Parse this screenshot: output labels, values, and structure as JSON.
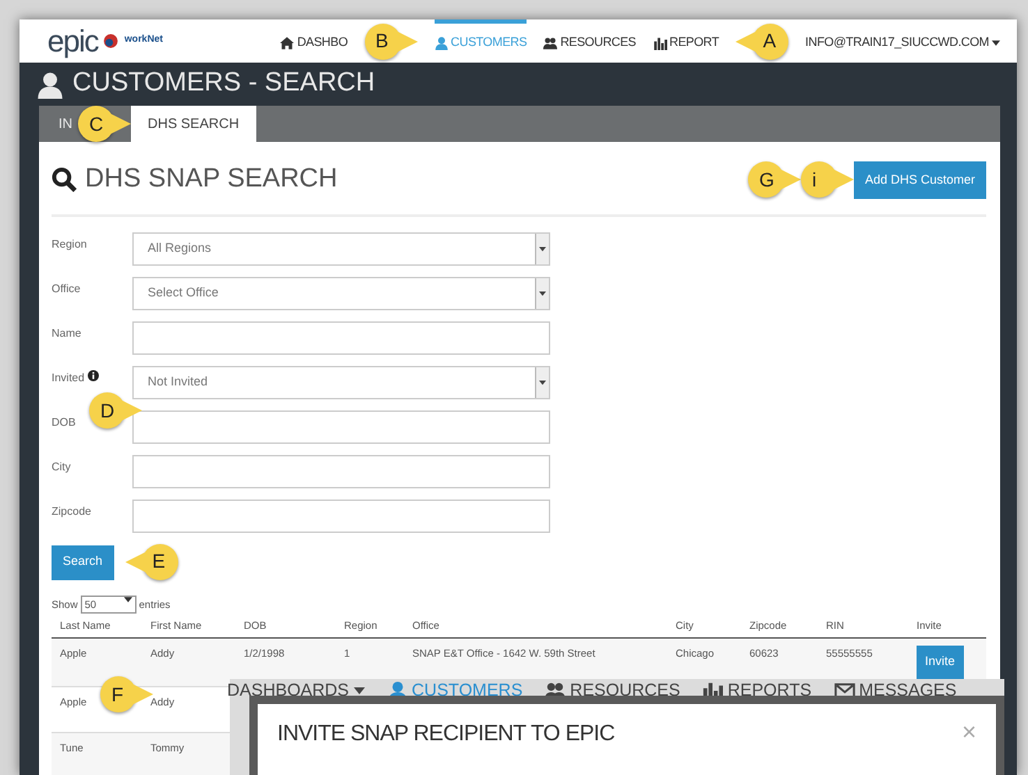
{
  "navbar": {
    "logo": "epic",
    "partner_logo": "workNet",
    "items": [
      {
        "label": "DASHBO",
        "selected": false
      },
      {
        "label": "CUSTOMERS",
        "selected": true
      },
      {
        "label": "RESOURCES",
        "selected": false
      },
      {
        "label": "REPORT",
        "selected": false
      },
      {
        "label": "INFO@TRAIN17_SIUCCWD.COM",
        "selected": false
      }
    ]
  },
  "page_title": "CUSTOMERS - SEARCH",
  "tabs": [
    {
      "label": "IN",
      "selected": false
    },
    {
      "label": "DHS SEARCH",
      "selected": true
    }
  ],
  "panel": {
    "title": "DHS SNAP SEARCH",
    "add_button": "Add DHS Customer"
  },
  "form": [
    {
      "kind": "select",
      "label": "Region",
      "value": "All Regions"
    },
    {
      "kind": "select",
      "label": "Office",
      "value": "Select Office"
    },
    {
      "kind": "text",
      "label": "Name"
    },
    {
      "kind": "select",
      "label": "Invited",
      "value": "Not Invited",
      "info": true
    },
    {
      "kind": "text",
      "label": "DOB"
    },
    {
      "kind": "text",
      "label": "City"
    },
    {
      "kind": "text",
      "label": "Zipcode"
    }
  ],
  "search_button": "Search",
  "length_control": {
    "before": "Show",
    "value": "50",
    "after": "entries"
  },
  "table": {
    "columns": [
      "Last Name",
      "First Name",
      "DOB",
      "Region",
      "Office",
      "City",
      "Zipcode",
      "RIN",
      "Invite"
    ],
    "rows": [
      [
        "Apple",
        "Addy",
        "1/2/1998",
        "1",
        "SNAP E&T Office - 1642 W. 59th Street",
        "Chicago",
        "60623",
        "55555555",
        "Invite"
      ],
      [
        "Apple",
        "Addy"
      ],
      [
        "Tune",
        "Tommy"
      ]
    ]
  },
  "overlay": {
    "nav_items": [
      {
        "label": "DASHBOARDS",
        "selected": false
      },
      {
        "label": "CUSTOMERS",
        "selected": true
      },
      {
        "label": "RESOURCES",
        "selected": false
      },
      {
        "label": "REPORTS",
        "selected": false
      },
      {
        "label": "MESSAGES",
        "selected": false
      }
    ],
    "modal_title": "INVITE SNAP RECIPIENT TO EPIC",
    "close": "×"
  },
  "callouts": [
    {
      "letter": "A"
    },
    {
      "letter": "B"
    },
    {
      "letter": "C"
    },
    {
      "letter": "D"
    },
    {
      "letter": "E"
    },
    {
      "letter": "F"
    },
    {
      "letter": "G"
    },
    {
      "letter": "i"
    }
  ]
}
